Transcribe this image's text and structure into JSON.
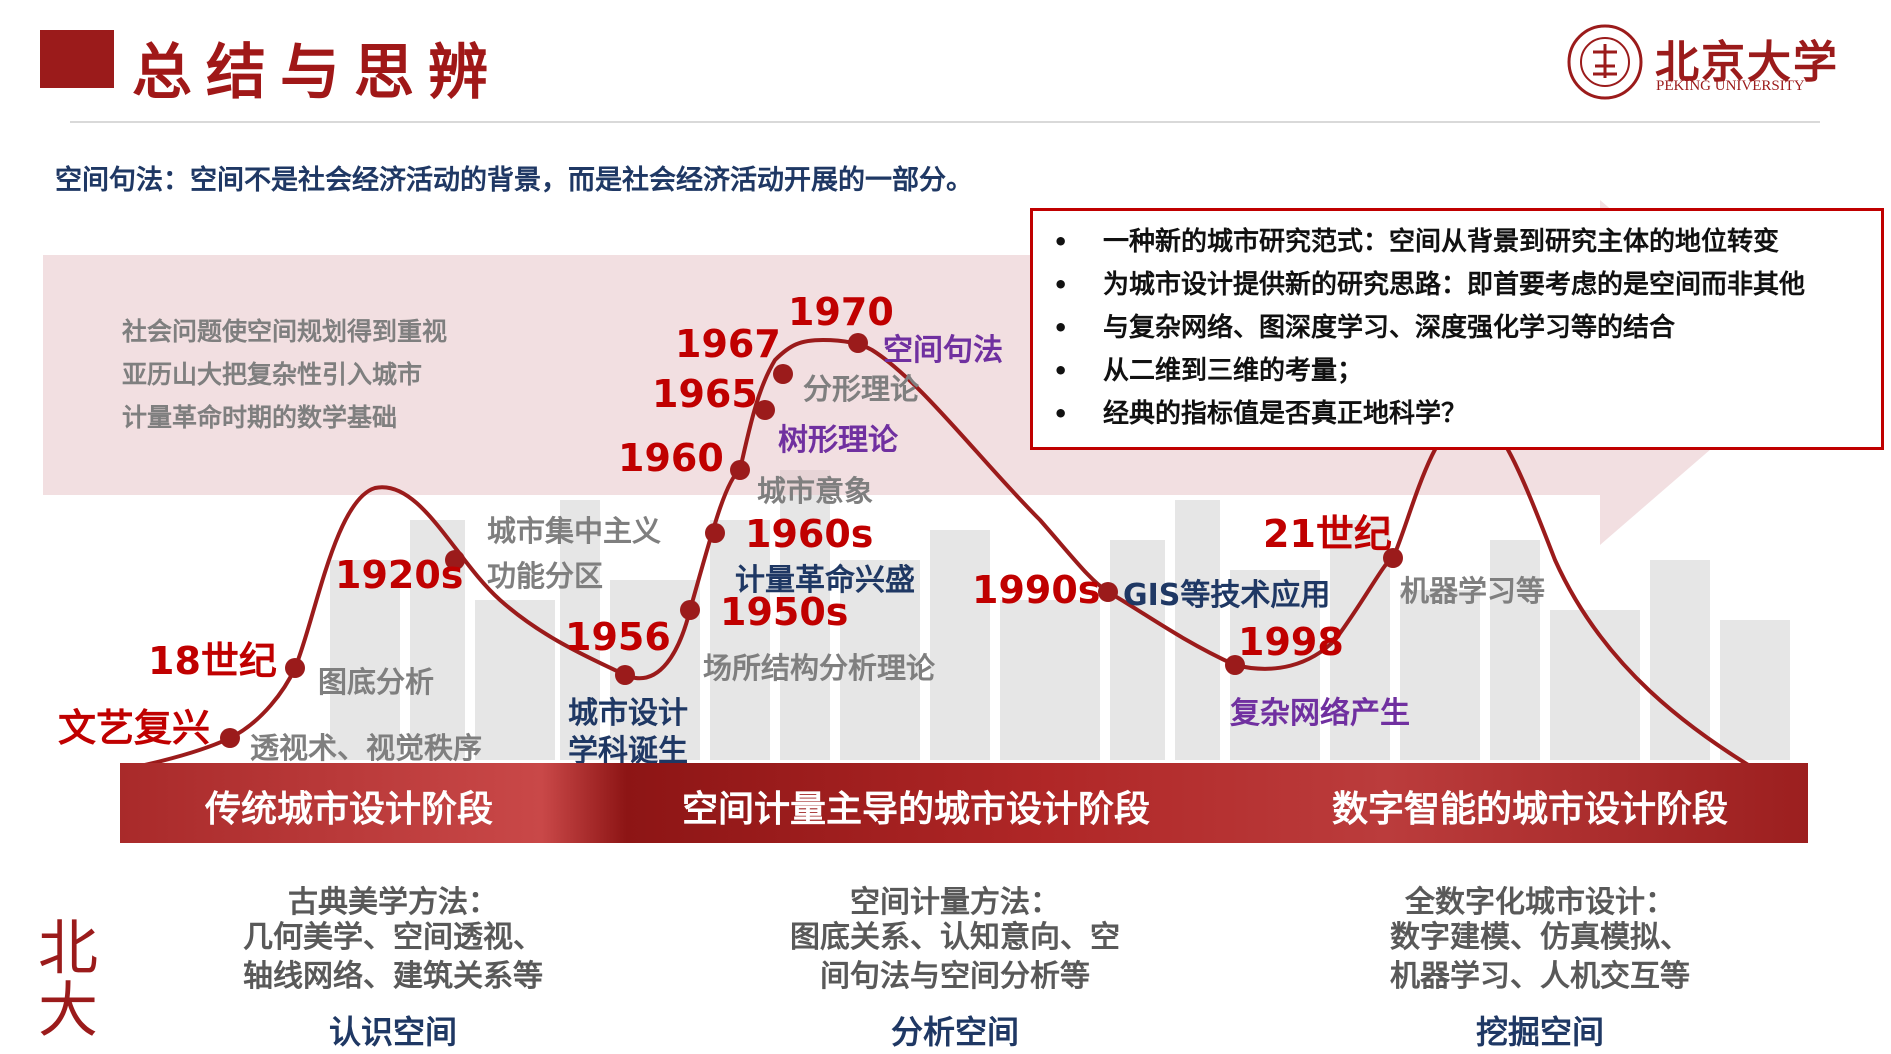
{
  "header": {
    "title": "总结与思辨",
    "logo_cn": "北京大学",
    "logo_en": "PEKING UNIVERSITY"
  },
  "subtitle": "空间句法：空间不是社会经济活动的背景，而是社会经济活动开展的一部分。",
  "grey_notes": [
    "社会问题使空间规划得到重视",
    "亚历山大把复杂性引入城市",
    "计量革命时期的数学基础"
  ],
  "box_items": [
    "一种新的城市研究范式：空间从背景到研究主体的地位转变",
    "为城市设计提供新的研究思路：即首要考虑的是空间而非其他",
    "与复杂网络、图深度学习、深度强化学习等的结合",
    "从二维到三维的考量；",
    "经典的指标值是否真正地科学？"
  ],
  "timeline": {
    "years": {
      "renaissance": "文艺复兴",
      "c18": "18世纪",
      "y1920s": "1920s",
      "y1956": "1956",
      "y1950s": "1950s",
      "y1960s": "1960s",
      "y1960": "1960",
      "y1965": "1965",
      "y1967": "1967",
      "y1970": "1970",
      "y1990s": "1990s",
      "y1998": "1998",
      "c21": "21世纪"
    },
    "annotations": {
      "perspective": "透视术、视觉秩序",
      "figure_ground": "图底分析",
      "centralism": "城市集中主义",
      "zoning": "功能分区",
      "place_structure": "场所结构分析理论",
      "city_image": "城市意象",
      "fractal": "分形理论",
      "machine_learning": "机器学习等"
    },
    "blue_labels": {
      "urban_design_1": "城市设计",
      "urban_design_2": "学科诞生",
      "quant_revolution": "计量革命兴盛",
      "gis": "GIS等技术应用"
    },
    "purple_labels": {
      "tree": "树形理论",
      "space_syntax": "空间句法",
      "complex_network": "复杂网络产生"
    }
  },
  "phases": [
    "传统城市设计阶段",
    "空间计量主导的城市设计阶段",
    "数字智能的城市设计阶段"
  ],
  "methods": [
    {
      "head": "古典美学方法：",
      "line1": "几何美学、空间透视、",
      "line2": "轴线网络、建筑关系等",
      "key": "认识空间"
    },
    {
      "head": "空间计量方法：",
      "line1": "图底关系、认知意向、空",
      "line2": "间句法与空间分析等",
      "key": "分析空间"
    },
    {
      "head": "全数字化城市设计：",
      "line1": "数字建模、仿真模拟、",
      "line2": "机器学习、人机交互等",
      "key": "挖掘空间"
    }
  ],
  "side_mark": "北大",
  "colors": {
    "brand_red": "#9b1b1b",
    "year_red": "#c00000",
    "navy": "#1f3864",
    "purple": "#7030a0",
    "grey": "#7f7f7f"
  }
}
